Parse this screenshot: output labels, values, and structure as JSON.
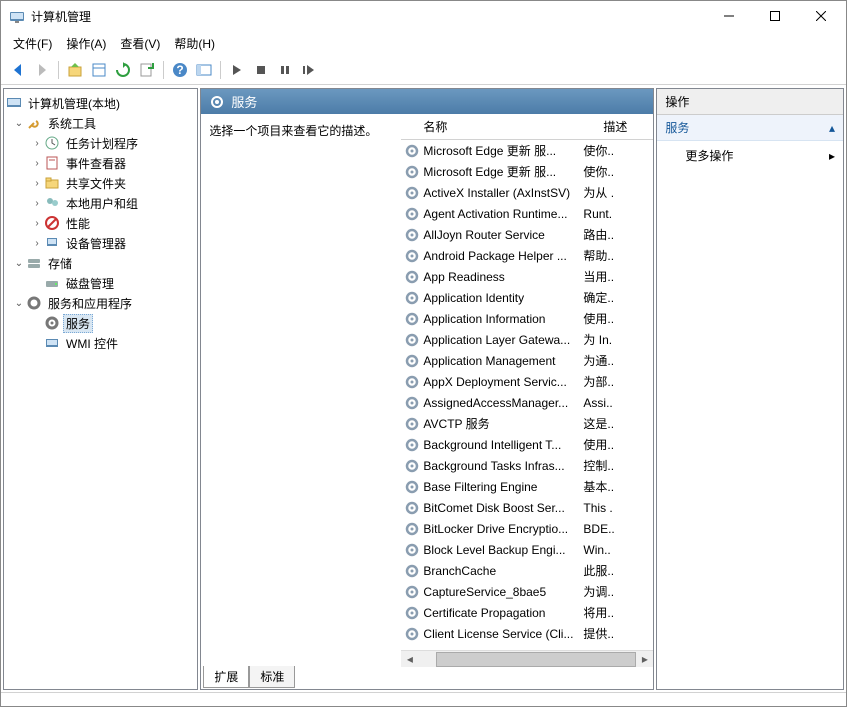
{
  "window": {
    "title": "计算机管理"
  },
  "menu": [
    "文件(F)",
    "操作(A)",
    "查看(V)",
    "帮助(H)"
  ],
  "tree": {
    "root": "计算机管理(本地)",
    "systools": "系统工具",
    "systools_items": [
      "任务计划程序",
      "事件查看器",
      "共享文件夹",
      "本地用户和组",
      "性能",
      "设备管理器"
    ],
    "storage": "存储",
    "storage_items": [
      "磁盘管理"
    ],
    "svcapps": "服务和应用程序",
    "svcapps_items": [
      "服务",
      "WMI 控件"
    ]
  },
  "center": {
    "title": "服务",
    "desc_prompt": "选择一个项目来查看它的描述。",
    "col_name": "名称",
    "col_desc": "描述",
    "tabs": [
      "扩展",
      "标准"
    ]
  },
  "services": [
    {
      "name": "Microsoft Edge 更新 服...",
      "desc": "使你.."
    },
    {
      "name": "Microsoft Edge 更新 服...",
      "desc": "使你.."
    },
    {
      "name": "ActiveX Installer (AxInstSV)",
      "desc": "为从 ."
    },
    {
      "name": "Agent Activation Runtime...",
      "desc": "Runt."
    },
    {
      "name": "AllJoyn Router Service",
      "desc": "路由.."
    },
    {
      "name": "Android Package Helper ...",
      "desc": "帮助.."
    },
    {
      "name": "App Readiness",
      "desc": "当用.."
    },
    {
      "name": "Application Identity",
      "desc": "确定.."
    },
    {
      "name": "Application Information",
      "desc": "使用.."
    },
    {
      "name": "Application Layer Gatewa...",
      "desc": "为 In."
    },
    {
      "name": "Application Management",
      "desc": "为通.."
    },
    {
      "name": "AppX Deployment Servic...",
      "desc": "为部.."
    },
    {
      "name": "AssignedAccessManager...",
      "desc": "Assi.."
    },
    {
      "name": "AVCTP 服务",
      "desc": "这是.."
    },
    {
      "name": "Background Intelligent T...",
      "desc": "使用.."
    },
    {
      "name": "Background Tasks Infras...",
      "desc": "控制.."
    },
    {
      "name": "Base Filtering Engine",
      "desc": "基本.."
    },
    {
      "name": "BitComet Disk Boost Ser...",
      "desc": "This ."
    },
    {
      "name": "BitLocker Drive Encryptio...",
      "desc": "BDE.."
    },
    {
      "name": "Block Level Backup Engi...",
      "desc": "Win.."
    },
    {
      "name": "BranchCache",
      "desc": "此服.."
    },
    {
      "name": "CaptureService_8bae5",
      "desc": "为调.."
    },
    {
      "name": "Certificate Propagation",
      "desc": "将用.."
    },
    {
      "name": "Client License Service (Cli...",
      "desc": "提供.."
    }
  ],
  "actions": {
    "header": "操作",
    "category": "服务",
    "more": "更多操作"
  }
}
